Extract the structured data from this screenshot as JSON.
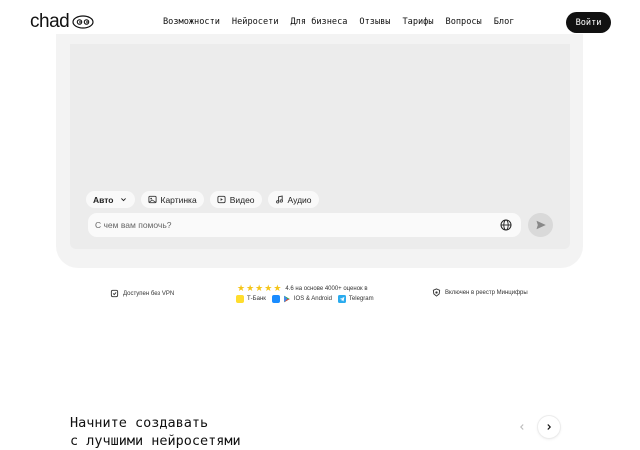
{
  "header": {
    "logo_text": "chad",
    "logo_icon": "glasses-icon",
    "nav": [
      {
        "label": "Возможности"
      },
      {
        "label": "Нейросети"
      },
      {
        "label": "Для бизнеса"
      },
      {
        "label": "Отзывы"
      },
      {
        "label": "Тарифы"
      },
      {
        "label": "Вопросы"
      },
      {
        "label": "Блог"
      }
    ],
    "login_label": "Войти"
  },
  "chat": {
    "modes": [
      {
        "label": "Авто",
        "icon": "chevron-down-icon"
      },
      {
        "label": "Картинка",
        "icon": "image-icon"
      },
      {
        "label": "Видео",
        "icon": "video-icon"
      },
      {
        "label": "Аудио",
        "icon": "music-note-icon"
      }
    ],
    "input_placeholder": "С чем вам помочь?",
    "globe_icon": "globe-icon",
    "send_icon": "send-icon"
  },
  "info": {
    "vpn": "Доступен без VPN",
    "rating_text": "4.6 на основе 4000+ оценок в",
    "stars": 5,
    "stores": [
      {
        "label": "Т-Банк",
        "color": "#ffdd2d"
      },
      {
        "label": "IOS & Android",
        "color": "#1a8cff"
      },
      {
        "label": "Telegram",
        "color": "#2aabee"
      }
    ],
    "registry": "Включен в реестр Минцифры"
  },
  "section": {
    "title_line1": "Начните создавать",
    "title_line2": "с лучшими нейросетями"
  },
  "colors": {
    "accent": "#111111",
    "star": "#f5c518",
    "frame": "#ececec"
  }
}
